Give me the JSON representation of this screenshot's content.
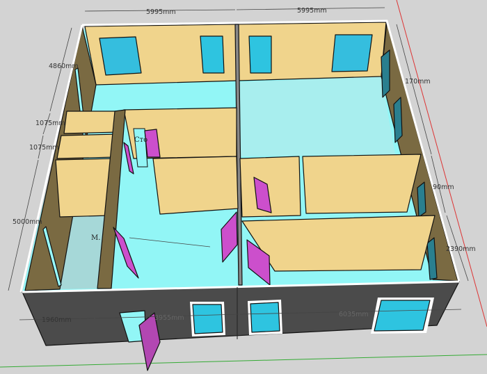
{
  "colors": {
    "floor": "#92f6f6",
    "wall": "#f0d48c",
    "wall_side": "#7a6a42",
    "exterior": "#4b4b4b",
    "window": "#2ec4e0",
    "door": "#cc4fcc",
    "background": "#d3d3d3"
  },
  "dimensions": {
    "top_left": "5995mm",
    "top_right": "5995mm",
    "left_upper": "4860mm",
    "left_mid_1": "1075mm",
    "left_mid_2": "1075mm",
    "left_lower": "5000mm",
    "right_upper": "170mm",
    "right_mid": "90mm",
    "right_lower": "2390mm",
    "bottom_left": "1960mm",
    "bottom_mid": "3955mm",
    "bottom_right": "6035mm"
  },
  "room_labels": {
    "hall": "Сто",
    "room": "М."
  }
}
